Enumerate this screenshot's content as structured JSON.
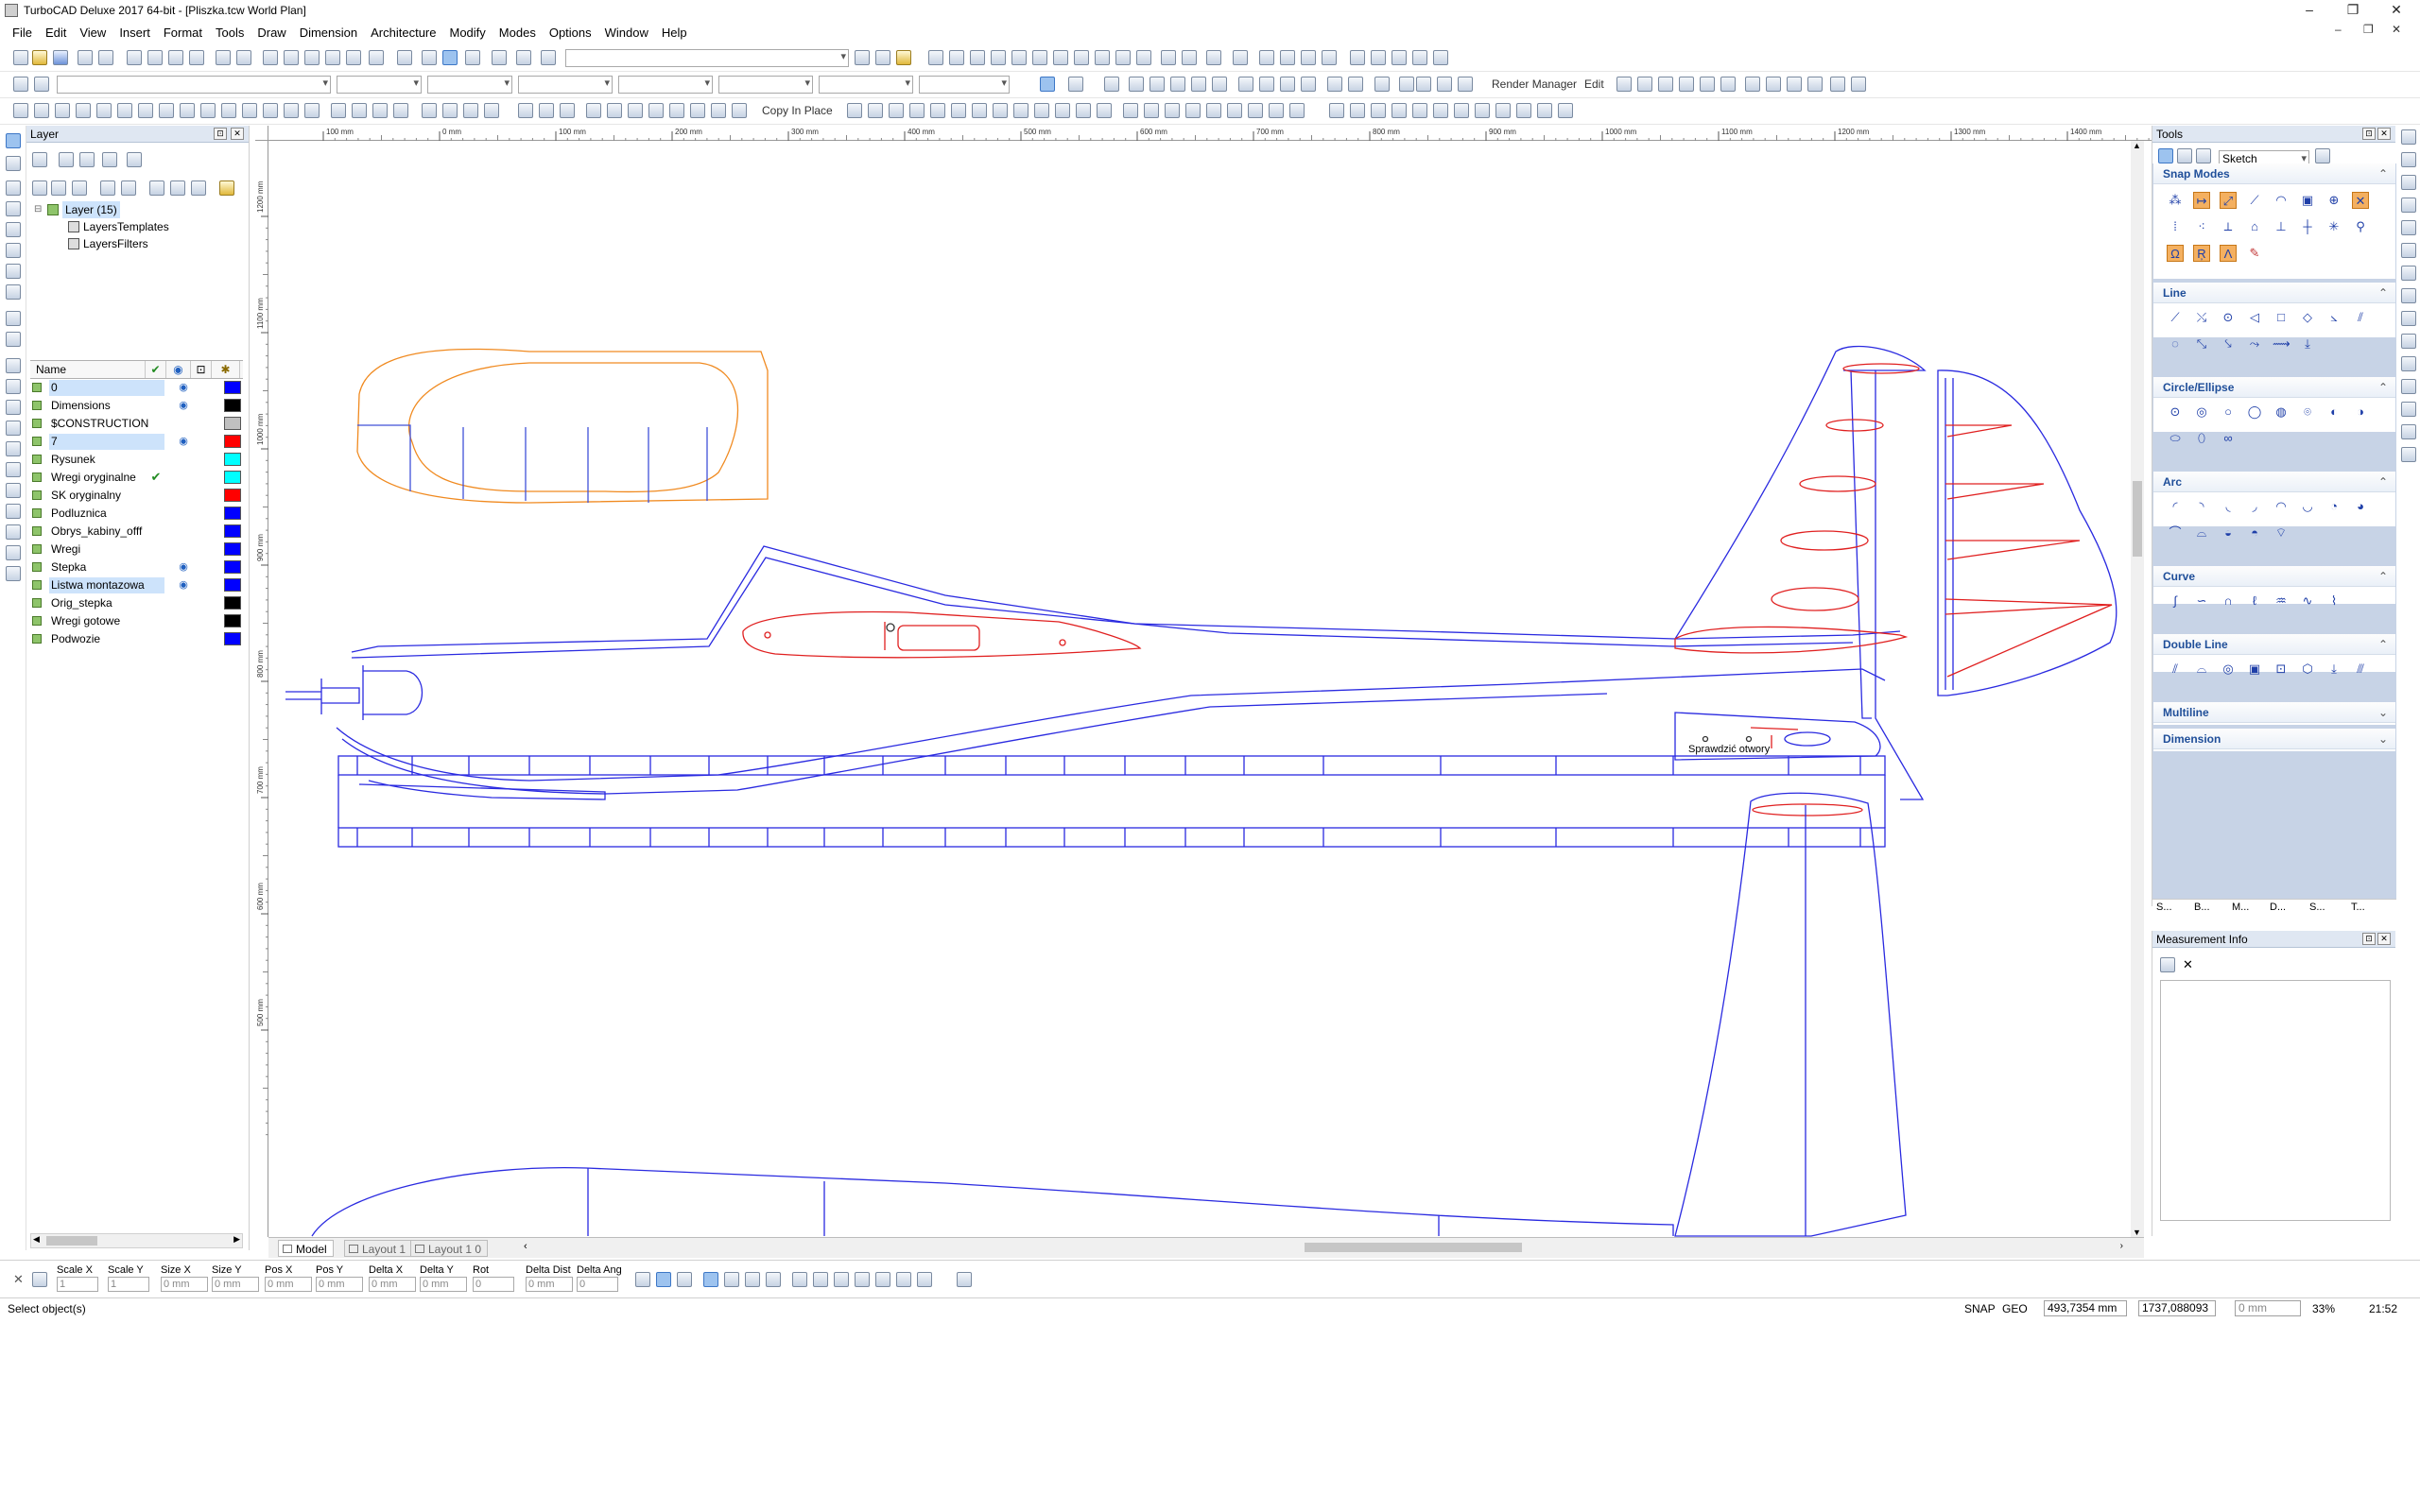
{
  "window": {
    "title": "TurboCAD Deluxe 2017 64-bit - [Pliszka.tcw World Plan]"
  },
  "menu": [
    "File",
    "Edit",
    "View",
    "Insert",
    "Format",
    "Tools",
    "Draw",
    "Dimension",
    "Architecture",
    "Modify",
    "Modes",
    "Options",
    "Window",
    "Help"
  ],
  "toolbar": {
    "copy_in_place": "Copy In Place",
    "render_manager": "Render Manager",
    "edit": "Edit"
  },
  "layer_panel": {
    "title": "Layer",
    "tree": [
      "Layer (15)",
      "LayersTemplates",
      "LayersFilters"
    ],
    "column_name": "Name",
    "layers": [
      {
        "name": "0",
        "visible": true,
        "current": false,
        "color": "#0000ff",
        "selected": true
      },
      {
        "name": "Dimensions",
        "visible": true,
        "current": false,
        "color": "#000000",
        "selected": false
      },
      {
        "name": "$CONSTRUCTION",
        "visible": false,
        "current": false,
        "color": "#c0c0c0",
        "selected": false
      },
      {
        "name": "7",
        "visible": true,
        "current": false,
        "color": "#ff0000",
        "selected": true
      },
      {
        "name": "Rysunek",
        "visible": false,
        "current": false,
        "color": "#00ffff",
        "selected": false
      },
      {
        "name": "Wregi oryginalne",
        "visible": false,
        "current": true,
        "color": "#00ffff",
        "selected": false
      },
      {
        "name": "SK oryginalny",
        "visible": false,
        "current": false,
        "color": "#ff0000",
        "selected": false
      },
      {
        "name": "Podluznica",
        "visible": false,
        "current": false,
        "color": "#0000ff",
        "selected": false
      },
      {
        "name": "Obrys_kabiny_offf",
        "visible": false,
        "current": false,
        "color": "#0000ff",
        "selected": false
      },
      {
        "name": "Wregi",
        "visible": false,
        "current": false,
        "color": "#0000ff",
        "selected": false
      },
      {
        "name": "Stepka",
        "visible": true,
        "current": false,
        "color": "#0000ff",
        "selected": false
      },
      {
        "name": "Listwa montazowa",
        "visible": true,
        "current": false,
        "color": "#0000ff",
        "selected": true
      },
      {
        "name": "Orig_stepka",
        "visible": false,
        "current": false,
        "color": "#000000",
        "selected": false
      },
      {
        "name": "Wregi gotowe",
        "visible": false,
        "current": false,
        "color": "#000000",
        "selected": false
      },
      {
        "name": "Podwozie",
        "visible": false,
        "current": false,
        "color": "#0000ff",
        "selected": false
      }
    ]
  },
  "ruler": {
    "h_ticks": [
      "100 mm",
      "0 mm",
      "100 mm",
      "200 mm",
      "300 mm",
      "400 mm",
      "500 mm",
      "600 mm",
      "700 mm",
      "800 mm",
      "900 mm",
      "1000 mm",
      "1100 mm",
      "1200 mm",
      "1300 mm",
      "1400 mm"
    ],
    "v_ticks": [
      "1200 mm",
      "1100 mm",
      "1000 mm",
      "900 mm",
      "800 mm",
      "700 mm",
      "600 mm",
      "500 mm"
    ]
  },
  "drawing": {
    "annotation": "Sprawdzić otwory"
  },
  "layout_tabs": [
    "Model",
    "Layout 1",
    "Layout 1 0"
  ],
  "tools_panel": {
    "title": "Tools",
    "mode": "Sketch",
    "sections": [
      "Snap Modes",
      "Line",
      "Circle/Ellipse",
      "Arc",
      "Curve",
      "Double Line",
      "Multiline",
      "Dimension"
    ],
    "bottom_tabs": [
      "S...",
      "B...",
      "M...",
      "D...",
      "S...",
      "T..."
    ]
  },
  "measurement_panel": {
    "title": "Measurement Info"
  },
  "inspector": {
    "fields": [
      {
        "label": "Scale X",
        "value": "1"
      },
      {
        "label": "Scale Y",
        "value": "1"
      },
      {
        "label": "Size X",
        "value": "0 mm"
      },
      {
        "label": "Size Y",
        "value": "0 mm"
      },
      {
        "label": "Pos X",
        "value": "0 mm"
      },
      {
        "label": "Pos Y",
        "value": "0 mm"
      },
      {
        "label": "Delta X",
        "value": "0 mm"
      },
      {
        "label": "Delta Y",
        "value": "0 mm"
      },
      {
        "label": "Rot",
        "value": "0"
      },
      {
        "label": "Delta Dist",
        "value": "0 mm"
      },
      {
        "label": "Delta Ang",
        "value": "0"
      }
    ]
  },
  "status": {
    "message": "Select object(s)",
    "snap": "SNAP",
    "geo": "GEO",
    "x": "493,7354 mm",
    "y": "1737,088093",
    "len": "0 mm",
    "zoom": "33%",
    "time": "21:52"
  }
}
